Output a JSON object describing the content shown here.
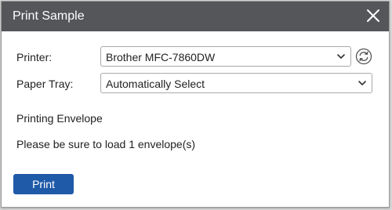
{
  "dialog": {
    "title": "Print Sample",
    "close_icon": "close-icon"
  },
  "form": {
    "printer_label": "Printer:",
    "printer_value": "Brother MFC-7860DW",
    "paper_tray_label": "Paper Tray:",
    "paper_tray_value": "Automatically Select",
    "refresh_icon": "refresh-icon",
    "dropdown_icon": "chevron-down-icon"
  },
  "info": {
    "heading": "Printing Envelope",
    "message": "Please be sure to load 1 envelope(s)"
  },
  "actions": {
    "print_label": "Print"
  },
  "colors": {
    "titlebar": "#54565a",
    "primary_button": "#1f5aa8"
  }
}
